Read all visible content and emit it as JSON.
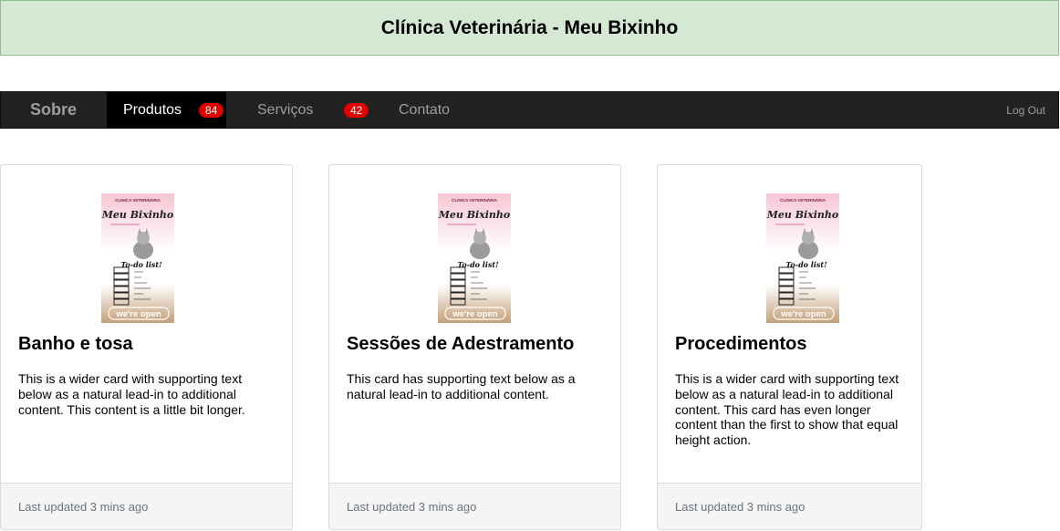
{
  "header": {
    "title": "Clínica Veterinária - Meu Bixinho"
  },
  "nav": {
    "brand": "Sobre",
    "items": [
      {
        "label": "Produtos",
        "badge": "84",
        "active": true
      },
      {
        "label": "Serviços",
        "badge": "42",
        "active": false
      },
      {
        "label": "Contato",
        "active": false
      }
    ],
    "logout": "Log Out"
  },
  "poster": {
    "top": "CLINICA VETERINÁRIA",
    "name": "Meu Bixinho",
    "todo": "To-do list!",
    "open": "we're open"
  },
  "cards": [
    {
      "title": "Banho e tosa",
      "text": "This is a wider card with supporting text below as a natural lead-in to additional content. This content is a little bit longer.",
      "footer": "Last updated 3 mins ago"
    },
    {
      "title": "Sessões de Adestramento",
      "text": "This card has supporting text below as a natural lead-in to additional content.",
      "footer": "Last updated 3 mins ago"
    },
    {
      "title": "Procedimentos",
      "text": "This is a wider card with supporting text below as a natural lead-in to additional content. This card has even longer content than the first to show that equal height action.",
      "footer": "Last updated 3 mins ago"
    }
  ],
  "colors": {
    "header_bg": "#d4e8d4",
    "navbar_bg": "#222222",
    "badge": "#e00000",
    "poster_pink": "#f7c6d3",
    "poster_tan": "#c4a07a"
  }
}
